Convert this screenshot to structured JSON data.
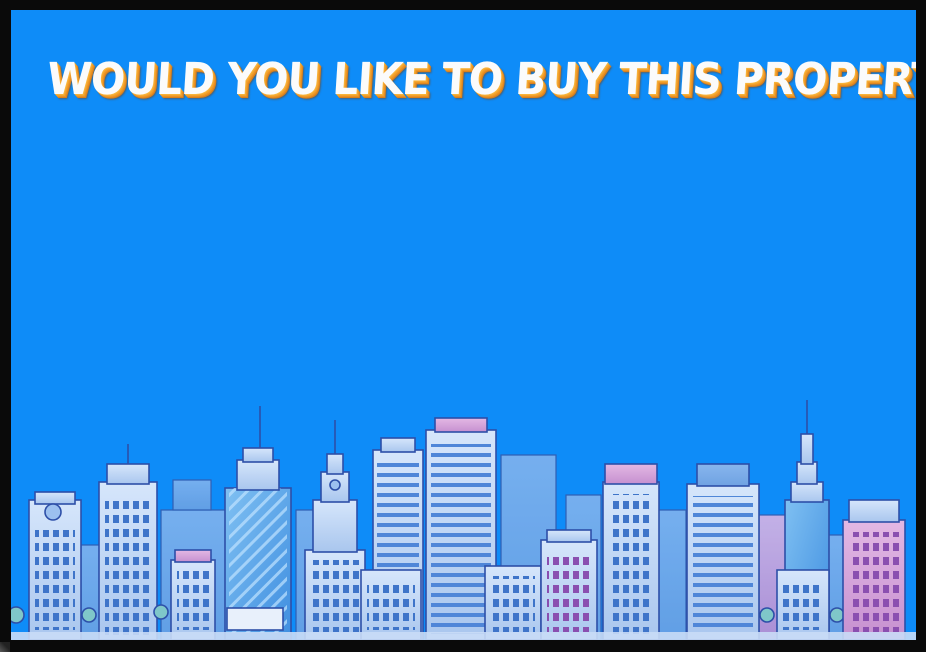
{
  "dialog": {
    "title": "WOULD YOU LIKE TO BUY THIS PROPERTY?"
  },
  "colors": {
    "background": "#0e8cf8",
    "title_fill": "#fbfbfb",
    "title_shadow": "#ea9224",
    "building_light": "#b8d4f6",
    "building_pink": "#d7a6dc",
    "building_outline": "#2d4fa8"
  },
  "scene": {
    "skyline_icon": "city-skyline-illustration"
  }
}
